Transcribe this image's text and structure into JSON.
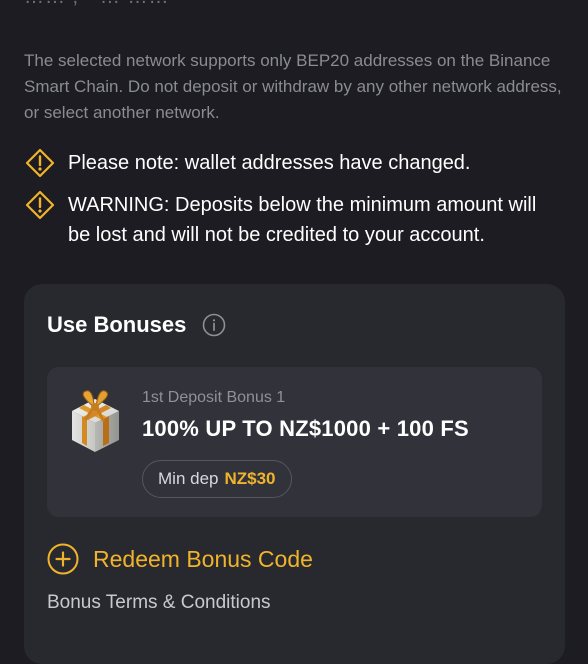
{
  "header_fragment": "…… ,  ·  …  ……",
  "network_note": "The selected network supports only BEP20 addresses on the Binance Smart Chain. Do not deposit or withdraw by any other network address, or select another network.",
  "notices": [
    {
      "icon": "warning-icon",
      "text": "Please note: wallet addresses have changed."
    },
    {
      "icon": "warning-icon",
      "text": "WARNING: Deposits below the minimum amount will be lost and will not be credited to your account."
    }
  ],
  "bonuses": {
    "title": "Use Bonuses",
    "info_icon": "info-icon",
    "offer": {
      "icon": "gift-icon",
      "subtitle": "1st Deposit Bonus 1",
      "title": "100% UP TO NZ$1000 + 100 FS",
      "min_dep_label": "Min dep",
      "min_dep_value": "NZ$30"
    },
    "redeem_label": "Redeem Bonus Code",
    "redeem_icon": "plus-circle-icon",
    "terms_label": "Bonus Terms & Conditions"
  },
  "colors": {
    "background": "#1c1c22",
    "card": "#28282f",
    "offer": "#32323a",
    "accent": "#f0b42c",
    "muted_text": "#8a8b93"
  }
}
